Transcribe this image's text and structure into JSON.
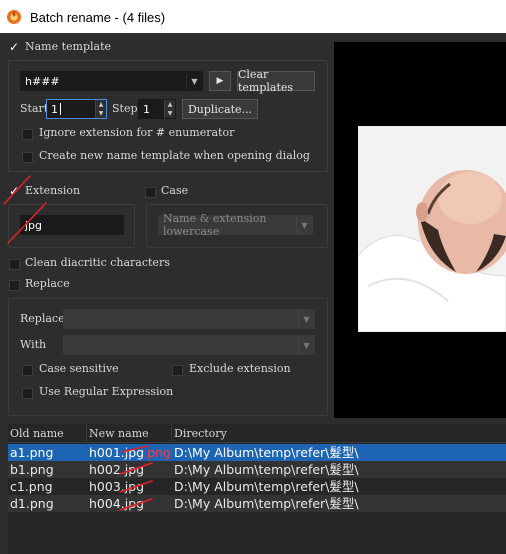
{
  "window": {
    "title": "Batch rename - (4 files)"
  },
  "name_template": {
    "label": "Name template",
    "checked": true,
    "template_value": "h###",
    "clear_templates_label": "Clear templates",
    "start_label": "Start",
    "start_value": "1",
    "step_label": "Step",
    "step_value": "1",
    "duplicate_label": "Duplicate...",
    "ignore_ext_label": "Ignore extension for # enumerator",
    "create_new_label": "Create new name template when opening dialog"
  },
  "extension": {
    "label": "Extension",
    "checked": true,
    "value": "jpg"
  },
  "case": {
    "label": "Case",
    "checked": false,
    "option": "Name & extension lowercase"
  },
  "clean_diacritic": {
    "label": "Clean diacritic characters",
    "checked": false
  },
  "replace": {
    "label": "Replace",
    "checked": false,
    "replace_label": "Replace",
    "with_label": "With",
    "case_sensitive_label": "Case sensitive",
    "exclude_extension_label": "Exclude extension",
    "regex_label": "Use Regular Expression"
  },
  "file_list": {
    "columns": [
      "Old name",
      "New name",
      "Directory"
    ],
    "rows": [
      {
        "old": "a1.png",
        "new": "h001.jpg",
        "correction": "png",
        "dir": "D:\\My Album\\temp\\refer\\髮型\\"
      },
      {
        "old": "b1.png",
        "new": "h002.jpg",
        "dir": "D:\\My Album\\temp\\refer\\髮型\\"
      },
      {
        "old": "c1.png",
        "new": "h003.jpg",
        "dir": "D:\\My Album\\temp\\refer\\髮型\\"
      },
      {
        "old": "d1.png",
        "new": "h004.jpg",
        "dir": "D:\\My Album\\temp\\refer\\髮型\\"
      }
    ]
  },
  "colors": {
    "selection": "#1e64b4",
    "annotation": "#e0202a",
    "background": "#2d2d2d"
  }
}
